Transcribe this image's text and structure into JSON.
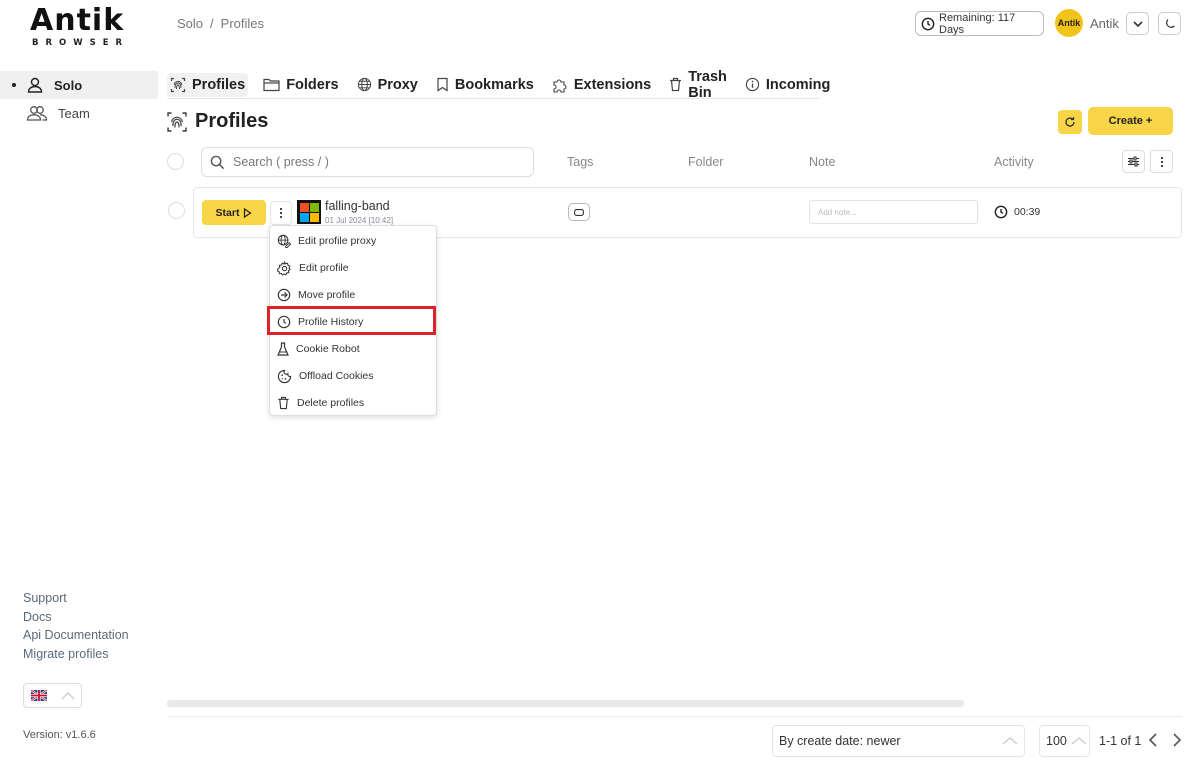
{
  "logo": {
    "main": "Antik",
    "sub": "BROWSER"
  },
  "breadcrumb": {
    "root": "Solo",
    "separator": "/",
    "current": "Profiles"
  },
  "topbar": {
    "remaining": "Remaining: 117 Days",
    "avatar_text": "Antik",
    "user_name": "Antik",
    "user_color": "#f2c318"
  },
  "sidebar": {
    "items": [
      {
        "label": "Solo",
        "icon": "user-icon",
        "active": true
      },
      {
        "label": "Team",
        "icon": "users-icon",
        "active": false
      }
    ],
    "links": [
      "Support",
      "Docs",
      "Api Documentation",
      "Migrate profiles"
    ],
    "language_icon": "uk-flag-icon",
    "version": "Version: v1.6.6"
  },
  "tabs": [
    {
      "label": "Profiles",
      "icon": "fingerprint-icon",
      "active": true
    },
    {
      "label": "Folders",
      "icon": "folder-icon"
    },
    {
      "label": "Proxy",
      "icon": "globe-icon"
    },
    {
      "label": "Bookmarks",
      "icon": "bookmark-icon"
    },
    {
      "label": "Extensions",
      "icon": "puzzle-icon"
    },
    {
      "label": "Trash Bin",
      "icon": "trash-icon"
    },
    {
      "label": "Incoming",
      "icon": "info-icon"
    }
  ],
  "page": {
    "title": "Profiles",
    "create_label": "Create +",
    "accent": "#f7d547"
  },
  "table": {
    "search_placeholder": "Search ( press / )",
    "columns": {
      "tags": "Tags",
      "folder": "Folder",
      "note": "Note",
      "activity": "Activity"
    }
  },
  "profile": {
    "start_label": "Start",
    "name": "falling-band",
    "date": "01 Jul 2024 [10:42]",
    "note_placeholder": "Add note...",
    "activity": "00:39"
  },
  "context_menu": {
    "items": [
      {
        "label": "Edit profile proxy",
        "icon": "globe-edit-icon"
      },
      {
        "label": "Edit profile",
        "icon": "gear-icon"
      },
      {
        "label": "Move profile",
        "icon": "arrow-right-circle-icon"
      },
      {
        "label": "Profile History",
        "icon": "history-icon",
        "highlighted": true
      },
      {
        "label": "Cookie Robot",
        "icon": "flask-icon"
      },
      {
        "label": "Offload Cookies",
        "icon": "cookie-icon"
      },
      {
        "label": "Delete profiles",
        "icon": "trash-icon"
      }
    ],
    "highlight_color": "#e0202a"
  },
  "footer": {
    "sort_label": "By create date: newer",
    "per_page": "100",
    "pager_text": "1-1 of 1"
  }
}
